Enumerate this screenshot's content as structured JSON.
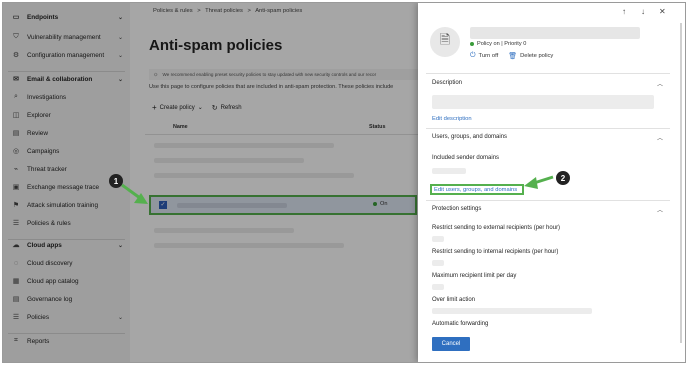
{
  "nav": {
    "items": [
      {
        "label": "Endpoints",
        "icon": "endpoints-icon",
        "glyph": "▭",
        "chevron": true,
        "bold": true
      },
      {
        "label": "Vulnerability management",
        "icon": "shield-bug-icon",
        "glyph": "⛉",
        "chevron": true
      },
      {
        "label": "Configuration management",
        "icon": "config-icon",
        "glyph": "⚙",
        "chevron": true
      },
      {
        "label": "Email & collaboration",
        "icon": "mail-icon",
        "glyph": "✉",
        "chevron": true,
        "bold": true
      },
      {
        "label": "Investigations",
        "icon": "investigation-icon",
        "glyph": "⌕"
      },
      {
        "label": "Explorer",
        "icon": "explorer-icon",
        "glyph": "◫"
      },
      {
        "label": "Review",
        "icon": "review-icon",
        "glyph": "▤"
      },
      {
        "label": "Campaigns",
        "icon": "campaigns-icon",
        "glyph": "◎"
      },
      {
        "label": "Threat tracker",
        "icon": "threat-tracker-icon",
        "glyph": "⌁"
      },
      {
        "label": "Exchange message trace",
        "icon": "exchange-icon",
        "glyph": "▣"
      },
      {
        "label": "Attack simulation training",
        "icon": "simulation-icon",
        "glyph": "⚑"
      },
      {
        "label": "Policies & rules",
        "icon": "policy-icon",
        "glyph": "☰"
      },
      {
        "label": "Cloud apps",
        "icon": "cloud-icon",
        "glyph": "☁",
        "chevron": true,
        "bold": true
      },
      {
        "label": "Cloud discovery",
        "icon": "cloud-discovery-icon",
        "glyph": "◌"
      },
      {
        "label": "Cloud app catalog",
        "icon": "catalog-icon",
        "glyph": "▦"
      },
      {
        "label": "Governance log",
        "icon": "log-icon",
        "glyph": "▤"
      },
      {
        "label": "Policies",
        "icon": "policies-icon",
        "glyph": "☰",
        "chevron": true
      },
      {
        "label": "Reports",
        "icon": "reports-icon",
        "glyph": "⌗"
      }
    ]
  },
  "breadcrumb": [
    "Policies & rules",
    ">",
    "Threat policies",
    ">",
    "Anti-spam policies"
  ],
  "page": {
    "title": "Anti-spam policies",
    "info": "We recommend enabling preset security policies to stay updated with new security controls and our recor",
    "description": "Use this page to configure policies that are included in anti-spam protection. These policies include",
    "create_label": "Create policy",
    "refresh_label": "Refresh",
    "col_name": "Name",
    "col_status": "Status",
    "selected_status": "On"
  },
  "flyout": {
    "status": "Policy on | Priority 0",
    "turn_off": "Turn off",
    "delete": "Delete policy",
    "description_title": "Description",
    "edit_description": "Edit description",
    "users_title": "Users, groups, and domains",
    "included_sender": "Included sender domains",
    "edit_users": "Edit users, groups, and domains",
    "protection_title": "Protection settings",
    "f1": "Restrict sending to external recipients (per hour)",
    "f2": "Restrict sending to internal recipients (per hour)",
    "f3": "Maximum recipient limit per day",
    "f4": "Over limit action",
    "f5": "Automatic forwarding",
    "cancel": "Cancel"
  },
  "callouts": {
    "one": "1",
    "two": "2"
  },
  "colors": {
    "accent": "#2f6fc0",
    "highlight": "#55b04e",
    "overlay": "rgba(0,0,0,0.35)"
  }
}
